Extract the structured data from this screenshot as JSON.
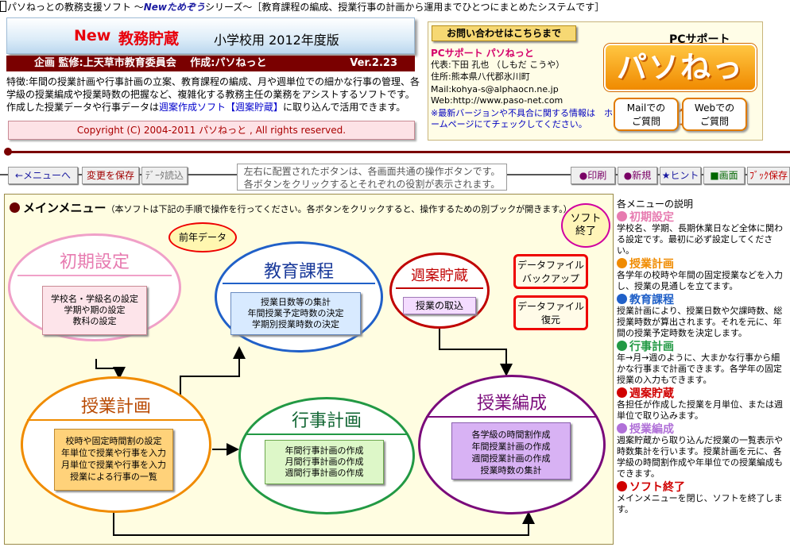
{
  "titlebar": {
    "prefix": "パソねっとの教務支援ソフト ～",
    "series_brand": "Newためぞう",
    "suffix": "シリーズ～［教育課程の編成、授業行事の計画から運用までひとつにまとめたシステムです］"
  },
  "app": {
    "new_label": "New",
    "name": "教務貯蔵",
    "edition": "小学校用 2012年度版",
    "credit": "企画 監修:上天草市教育委員会　 作成:パソねっと",
    "version": "Ver.2.23",
    "description_pre": "特徴:年間の授業計画や行事計画の立案、教育課程の編成、月や週単位での細かな行事の管理、各学級の授業編成や授業時数の把握など、複雑化する教務主任の業務をアシストするソフトです。作成した授業データや行事データは",
    "description_link": "週案作成ソフト【週案貯蔵】",
    "description_post": "に取り込んで活用できます。",
    "copyright": "Copyright (C) 2004-2011 パソねっと , All rights reserved."
  },
  "contact": {
    "header": "お問い合わせはこちらまで",
    "org": "PCサポート パソねっと",
    "rep": "代表:下田 孔也 （しもだ こうや）",
    "address": "住所:熊本県八代郡氷川町",
    "mail": "Mail:kohya-s@alphaocn.ne.jp",
    "web": "Web:http://www.paso-net.com",
    "notice": "※最新バージョンや不具合に関する情報は　ホームページにてチェックしてください。",
    "logo_small": "PCサポート",
    "logo_big": "パソねっと",
    "mail_btn": "Mailでの\nご質問",
    "web_btn": "Webでの\nご質問"
  },
  "toolbar": {
    "back": "←メニューへ",
    "save": "変更を保存",
    "load": "ﾃﾞｰﾀ読込",
    "info1": "左右に配置されたボタンは、各画面共通の操作ボタンです。",
    "info2": "各ボタンをクリックするとそれぞれの役割が表示されます。",
    "print": "●印刷",
    "new": "●新規",
    "hint": "★ヒント",
    "screen": "■画面",
    "book_save": "ﾌﾞｯｸ保存"
  },
  "main": {
    "title": "メインメニュー",
    "title_note": "（本ソフトは下記の手順で操作を行ってください。各ボタンをクリックすると、操作するための別ブックが開きます。）",
    "quit": "ソフト\n終了",
    "prev_data": "前年データ",
    "backup": "データファイル\nバックアップ",
    "restore": "データファイル\n復元",
    "shoki": {
      "title": "初期設定",
      "box": "学校名・学級名の設定\n学期や期の設定\n教科の設定"
    },
    "kyoiku": {
      "title": "教育課程",
      "box": "授業日数等の集計\n年間授業予定時数の決定\n学期別授業時数の決定"
    },
    "shuan": {
      "title": "週案貯蔵",
      "box": "授業の取込"
    },
    "jugyo": {
      "title": "授業計画",
      "box": "校時や固定時間割の設定\n年単位で授業や行事を入力\n月単位で授業や行事を入力\n授業による行事の一覧"
    },
    "gyoji": {
      "title": "行事計画",
      "box": "年間行事計画の作成\n月間行事計画の作成\n週間行事計画の作成"
    },
    "hensei": {
      "title": "授業編成",
      "box": "各学級の時間割作成\n年間授業計画の作成\n週間授業計画の作成\n授業時数の集計"
    }
  },
  "sidebar": {
    "title": "各メニューの説明",
    "items": [
      {
        "name": "初期設定",
        "color": "#e77bb0",
        "desc": "学校名、学期、長期休業日など全体に関わる設定です。最初に必ず設定してください。"
      },
      {
        "name": "授業計画",
        "color": "#f08b00",
        "desc": "各学年の校時や年間の固定授業などを入力し、授業の見通しを立てます。"
      },
      {
        "name": "教育課程",
        "color": "#2060c8",
        "desc": "授業計画により、授業日数や欠課時数、総授業時数が算出されます。それを元に、年間の授業予定時数を決定します。"
      },
      {
        "name": "行事計画",
        "color": "#229944",
        "desc": "年→月→週のように、大まかな行事から細かな行事まで計画できます。各学年の固定授業の入力もできます。"
      },
      {
        "name": "週案貯蔵",
        "color": "#d00000",
        "desc": "各担任が作成した授業を月単位、または週単位で取り込みます。"
      },
      {
        "name": "授業編成",
        "color": "#b070d8",
        "desc": "週案貯蔵から取り込んだ授業の一覧表示や時数集計を行います。授業計画を元に、各学級の時間割作成や年単位での授業編成もできます。"
      },
      {
        "name": "ソフト終了",
        "color": "#d00000",
        "desc": "メインメニューを閉じ、ソフトを終了します。"
      }
    ]
  }
}
